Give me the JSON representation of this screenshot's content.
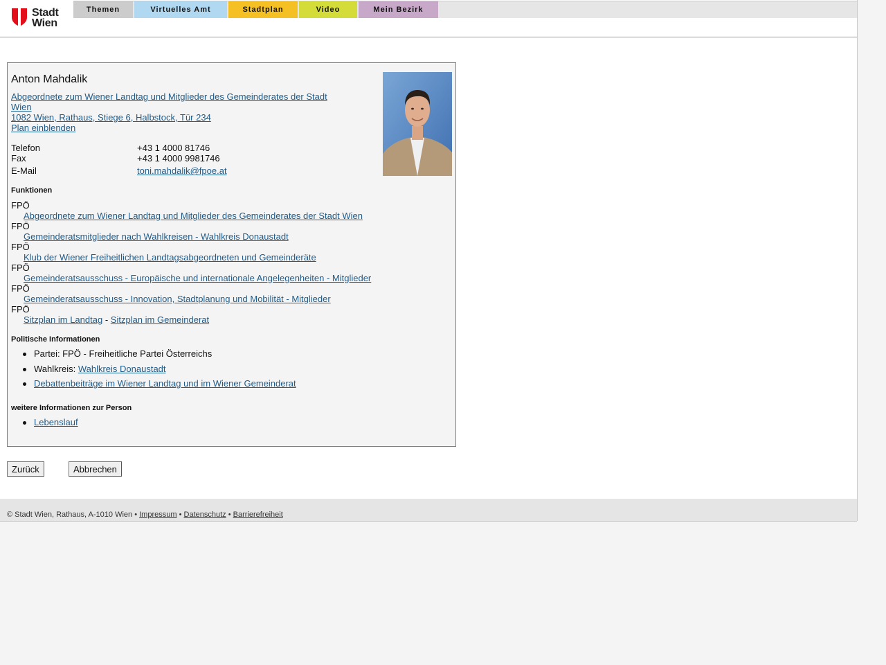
{
  "header": {
    "logo_line1": "Stadt",
    "logo_line2": "Wien",
    "nav": [
      {
        "label": "Themen",
        "color": "#cccccc"
      },
      {
        "label": "Virtuelles Amt",
        "color": "#b0d8f0"
      },
      {
        "label": "Stadtplan",
        "color": "#f5c024"
      },
      {
        "label": "Video",
        "color": "#d4dc3a"
      },
      {
        "label": "Mein Bezirk",
        "color": "#c8a8c8"
      }
    ]
  },
  "person": {
    "name": "Anton Mahdalik",
    "role_line1": "Abgeordnete zum Wiener Landtag und Mitglieder des Gemeinderates der Stadt",
    "role_line2": "Wien",
    "address": "1082 Wien, Rathaus, Stiege 6, Halbstock, Tür 234",
    "plan_link": "Plan einblenden",
    "contacts": [
      {
        "label": "Telefon",
        "value": "+43 1 4000 81746"
      },
      {
        "label": "Fax",
        "value": "+43 1 4000 9981746"
      },
      {
        "label": "E-Mail",
        "value": "toni.mahdalik@fpoe.at"
      }
    ]
  },
  "funktionen": {
    "heading": "Funktionen",
    "items": [
      {
        "party": "FPÖ",
        "link": "Abgeordnete zum Wiener Landtag und Mitglieder des Gemeinderates der Stadt Wien"
      },
      {
        "party": "FPÖ",
        "link": "Gemeinderatsmitglieder nach Wahlkreisen - Wahlkreis Donaustadt"
      },
      {
        "party": "FPÖ",
        "link": "Klub der Wiener Freiheitlichen Landtagsabgeordneten und Gemeinderäte"
      },
      {
        "party": "FPÖ",
        "link": "Gemeinderatsausschuss - Europäische und internationale Angelegenheiten - Mitglieder"
      },
      {
        "party": "FPÖ",
        "link": "Gemeinderatsausschuss - Innovation, Stadtplanung und Mobilität - Mitglieder"
      }
    ],
    "last_party": "FPÖ",
    "sitzplan_landtag": "Sitzplan im Landtag",
    "separator": "-",
    "sitzplan_gemeinderat": "Sitzplan im Gemeinderat"
  },
  "politisch": {
    "heading": "Politische Informationen",
    "partei": "Partei: FPÖ - Freiheitliche Partei Österreichs",
    "wahlkreis_label": "Wahlkreis:",
    "wahlkreis_link": "Wahlkreis Donaustadt",
    "debatten_link": "Debattenbeiträge im Wiener Landtag und im Wiener Gemeinderat"
  },
  "weitere": {
    "heading": "weitere Informationen zur Person",
    "lebenslauf": "Lebenslauf"
  },
  "buttons": {
    "back": "Zurück",
    "cancel": "Abbrechen"
  },
  "footer": {
    "copyright": "© Stadt Wien, Rathaus, A-1010 Wien",
    "sep": "•",
    "impressum": "Impressum",
    "datenschutz": "Datenschutz",
    "barrierefreiheit": "Barrierefreiheit"
  }
}
